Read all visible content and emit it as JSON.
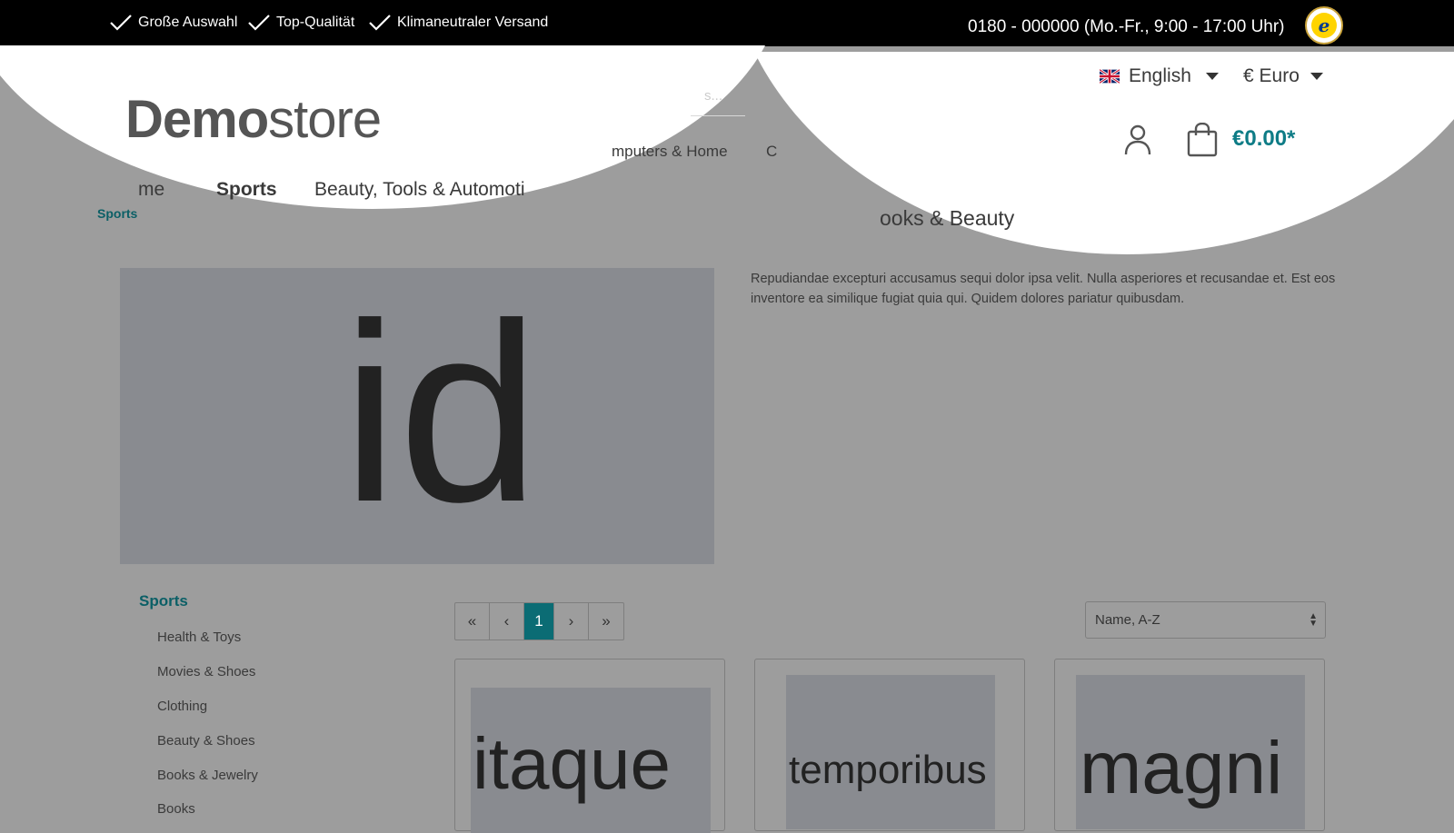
{
  "topbar": {
    "usps": [
      "Große Auswahl",
      "Top-Qualität",
      "Klimaneutraler Versand"
    ],
    "hotline": "0180 - 000000 (Mo.-Fr., 9:00 - 17:00 Uhr)",
    "trust_badge": "e"
  },
  "header": {
    "logo_bold": "Demo",
    "logo_light": "store",
    "search_placeholder_fragment": "s...",
    "language": "English",
    "currency": "€ Euro",
    "cart_total": "€0.00*"
  },
  "nav": {
    "home_fragment": "me",
    "sports": "Sports",
    "beauty": "Beauty, Tools & Automoti",
    "computers_fragment": "mputers & Home",
    "c_fragment": "C",
    "books_fragment": "ooks & Beauty"
  },
  "breadcrumb": "Sports",
  "hero": {
    "text": "id"
  },
  "description": "Repudiandae excepturi accusamus sequi dolor ipsa velit. Nulla asperiores et recusandae et. Est eos inventore ea similique fugiat quia qui. Quidem dolores pariatur quibusdam.",
  "sidebar": {
    "title": "Sports",
    "items": [
      "Health & Toys",
      "Movies & Shoes",
      "Clothing",
      "Beauty & Shoes",
      "Books & Jewelry",
      "Books"
    ]
  },
  "pagination": {
    "first": "«",
    "prev": "‹",
    "current": "1",
    "next": "›",
    "last": "»"
  },
  "sort": {
    "selected": "Name, A-Z"
  },
  "products": [
    {
      "image_text": "itaque"
    },
    {
      "image_text": "temporibus"
    },
    {
      "image_text": "magni"
    }
  ],
  "colors": {
    "accent": "#0e7c86",
    "overlay": "#9d9d9d"
  }
}
